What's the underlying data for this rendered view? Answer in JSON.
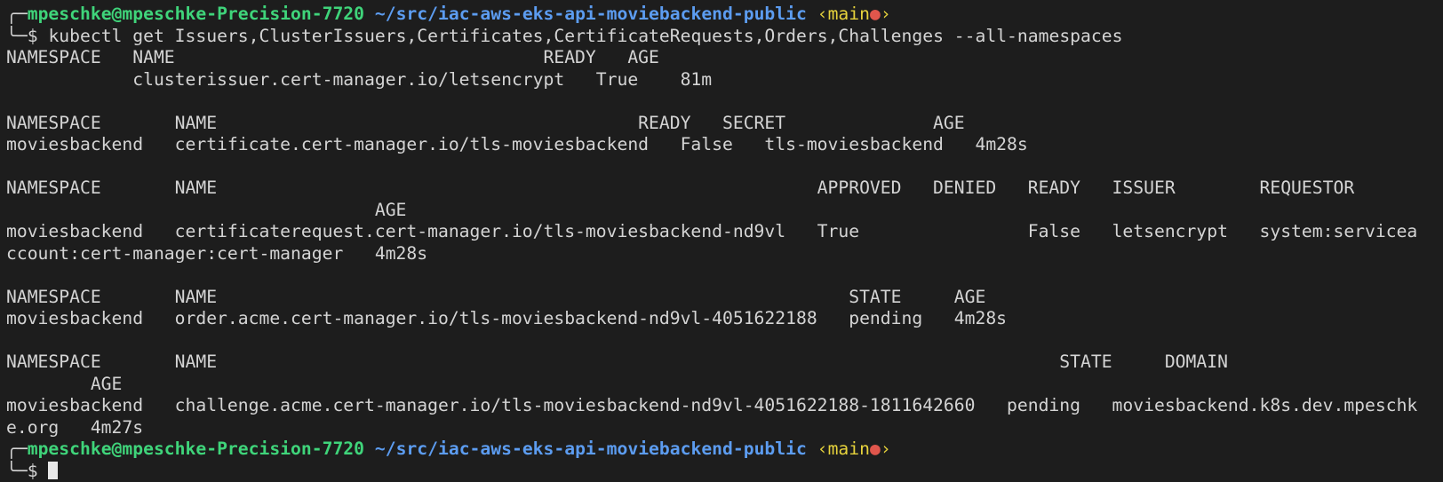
{
  "prompt": {
    "frame_top": "╭─",
    "frame_bottom": "╰─",
    "user_host": "mpeschke@mpeschke-Precision-7720",
    "path": "~/src/iac-aws-eks-api-moviebackend-public",
    "branch_open": "‹",
    "branch": "main",
    "dirty_marker": "●",
    "branch_close": "›",
    "symbol": "$ "
  },
  "command": "kubectl get Issuers,ClusterIssuers,Certificates,CertificateRequests,Orders,Challenges --all-namespaces",
  "output_lines": [
    "NAMESPACE   NAME                                   READY   AGE",
    "            clusterissuer.cert-manager.io/letsencrypt   True    81m",
    "",
    "NAMESPACE       NAME                                        READY   SECRET              AGE",
    "moviesbackend   certificate.cert-manager.io/tls-moviesbackend   False   tls-moviesbackend   4m28s",
    "",
    "NAMESPACE       NAME                                                         APPROVED   DENIED   READY   ISSUER        REQUESTOR",
    "                                   AGE",
    "moviesbackend   certificaterequest.cert-manager.io/tls-moviesbackend-nd9vl   True                False   letsencrypt   system:servicea",
    "ccount:cert-manager:cert-manager   4m28s",
    "",
    "NAMESPACE       NAME                                                            STATE     AGE",
    "moviesbackend   order.acme.cert-manager.io/tls-moviesbackend-nd9vl-4051622188   pending   4m28s",
    "",
    "NAMESPACE       NAME                                                                                STATE     DOMAIN",
    "        AGE",
    "moviesbackend   challenge.acme.cert-manager.io/tls-moviesbackend-nd9vl-4051622188-1811642660   pending   moviesbackend.k8s.dev.mpeschk",
    "e.org   4m27s"
  ]
}
